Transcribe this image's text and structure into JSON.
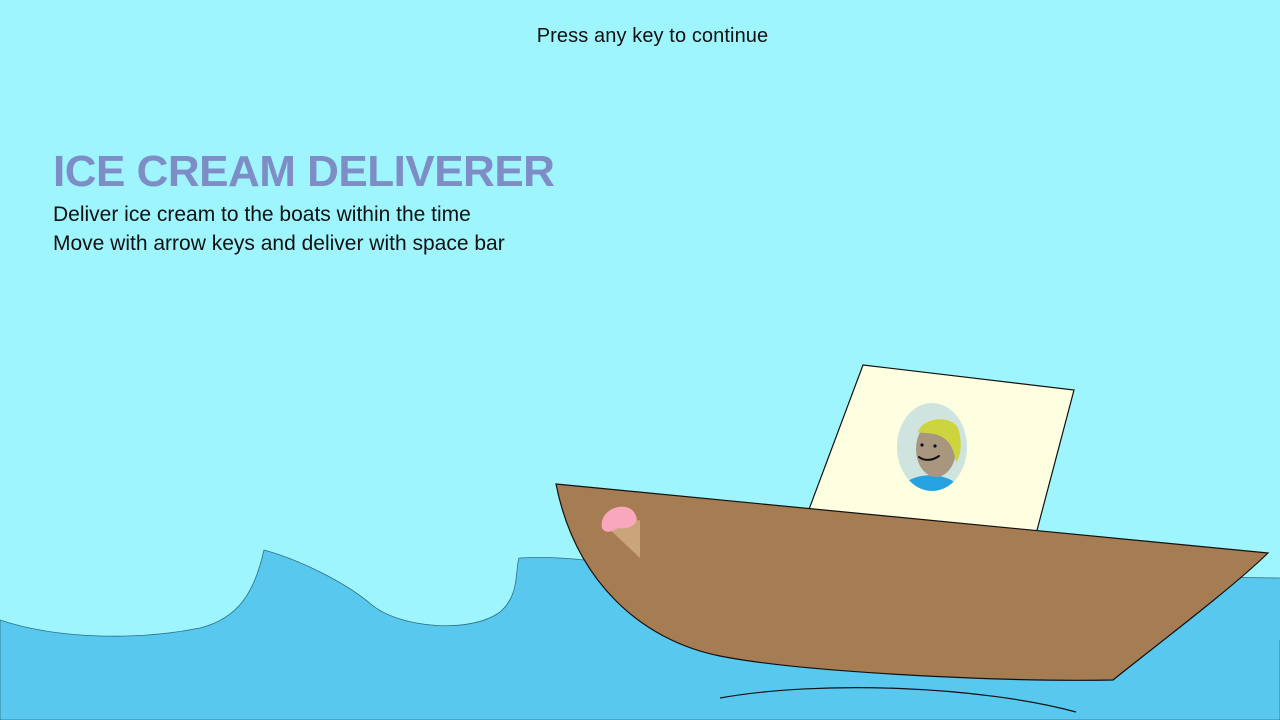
{
  "prompt": "Press any key to continue",
  "title": "ICE CREAM DELIVERER",
  "instructions": [
    "Deliver ice cream to the boats within the time",
    "Move with arrow keys and deliver with space bar"
  ],
  "colors": {
    "sky": "#9ef5fd",
    "sea": "#58c8ee",
    "title": "#7e8dc6",
    "boat_hull": "#a67c52",
    "cabin": "#fefee0",
    "portrait_bg": "#cfe4df",
    "skin": "#a8967f",
    "hair": "#cdd43e",
    "shirt": "#26a2e0",
    "ice_cream_scoop": "#f9a7bd",
    "ice_cream_cone": "#caa57a"
  },
  "icons": {
    "boat": "boat-icon",
    "ice_cream": "ice-cream-icon",
    "captain": "captain-portrait-icon"
  }
}
